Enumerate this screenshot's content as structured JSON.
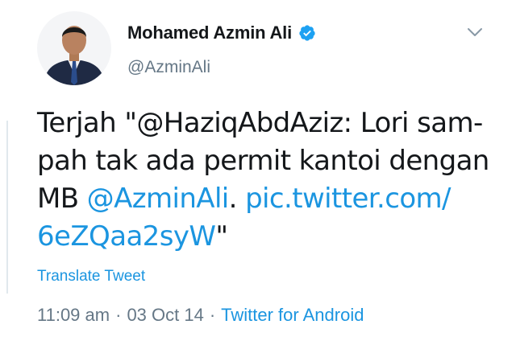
{
  "user": {
    "display_name": "Mohamed Azmin Ali",
    "handle": "@AzminAli",
    "verified": true,
    "verified_icon": "verified-badge-icon",
    "avatar_icon": "profile-photo"
  },
  "menu": {
    "icon": "chevron-down-icon"
  },
  "tweet": {
    "line1": "Terjah \"@HaziqAbdAziz: Lori sam-",
    "line2": "pah tak ada permit kantoi dengan",
    "line3_prefix": "MB ",
    "mention": "@AzminAli",
    "line3_mid": ". ",
    "link_part1": "pic.twitter.com/",
    "link_part2": "6eZQaa2syW",
    "line4_suffix": "\""
  },
  "translate_label": "Translate Tweet",
  "meta": {
    "time": "11:09 am",
    "separator": "·",
    "date": "03 Oct 14",
    "source": "Twitter for Android"
  },
  "colors": {
    "link": "#1b95e0",
    "text": "#14171a",
    "secondary": "#657786",
    "verified": "#1da1f2"
  }
}
